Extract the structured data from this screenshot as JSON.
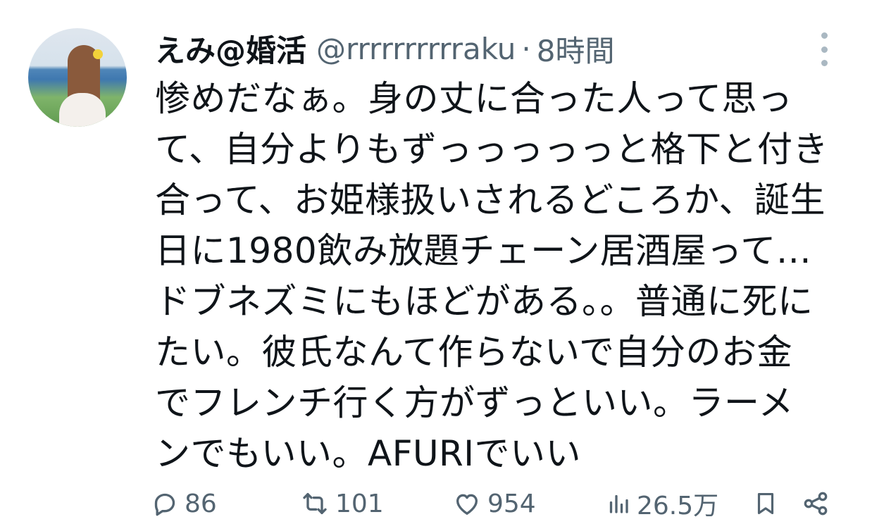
{
  "author": {
    "display_name": "えみ@婚活",
    "handle": "@rrrrrrrrrraku",
    "separator": "·",
    "time": "8時間"
  },
  "tweet": {
    "text": "惨めだなぁ。身の丈に合った人って思っ\nて、自分よりもずっっっっっと格下と付き\n合って、お姫様扱いされるどころか、誕生\n日に1980飲み放題チェーン居酒屋って…\nドブネズミにもほどがある。。普通に死に\nたい。彼氏なんて作らないで自分のお金\nでフレンチ行く方がずっといい。ラーメ\nンでもいい。AFURIでいい"
  },
  "actions": {
    "replies": "86",
    "retweets": "101",
    "likes": "954",
    "views": "26.5万"
  },
  "icons": {
    "reply": "reply-icon",
    "retweet": "retweet-icon",
    "like": "heart-icon",
    "views": "views-icon",
    "bookmark": "bookmark-icon",
    "share": "share-icon",
    "more": "more-vertical-icon"
  },
  "colors": {
    "text": "#0f1419",
    "secondary": "#536471"
  }
}
